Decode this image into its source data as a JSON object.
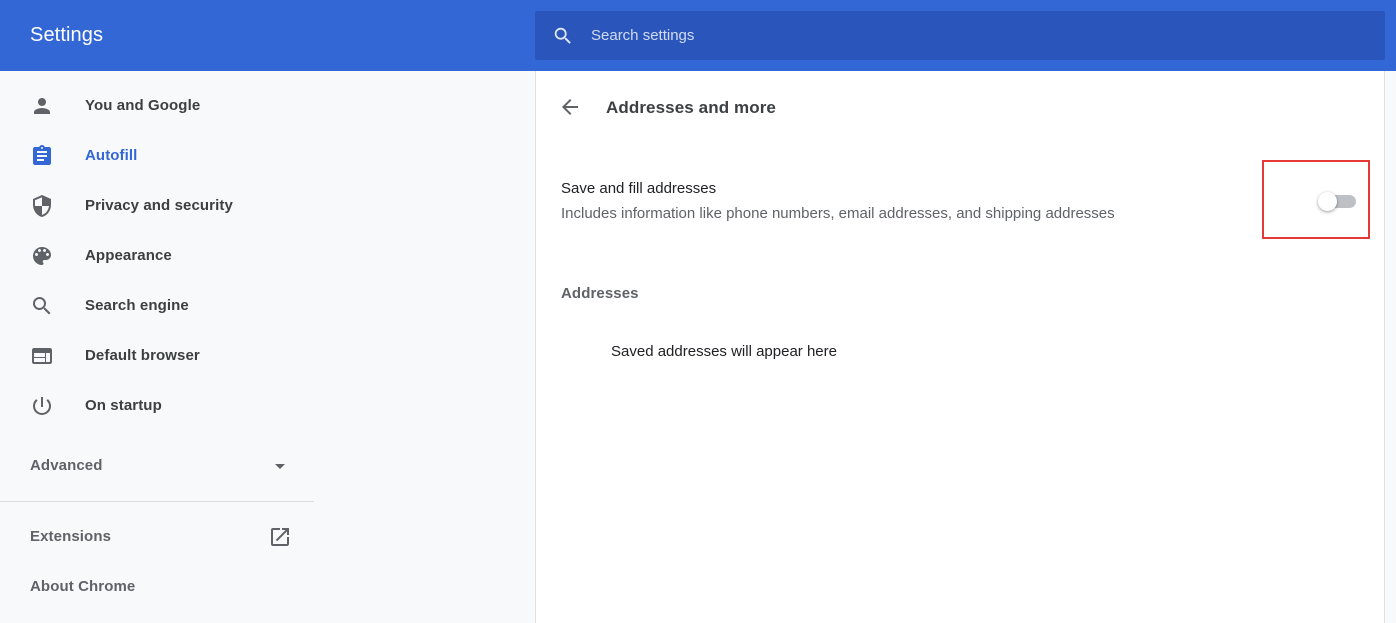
{
  "header": {
    "title": "Settings",
    "search_placeholder": "Search settings",
    "search_value": ""
  },
  "sidebar": {
    "items": [
      {
        "label": "You and Google",
        "icon": "person-icon",
        "active": false
      },
      {
        "label": "Autofill",
        "icon": "autofill-clipboard-icon",
        "active": true
      },
      {
        "label": "Privacy and security",
        "icon": "shield-icon",
        "active": false
      },
      {
        "label": "Appearance",
        "icon": "palette-icon",
        "active": false
      },
      {
        "label": "Search engine",
        "icon": "search-icon",
        "active": false
      },
      {
        "label": "Default browser",
        "icon": "browser-window-icon",
        "active": false
      },
      {
        "label": "On startup",
        "icon": "power-icon",
        "active": false
      }
    ],
    "advanced_label": "Advanced",
    "extensions_label": "Extensions",
    "about_label": "About Chrome"
  },
  "main": {
    "title": "Addresses and more",
    "save_fill": {
      "title": "Save and fill addresses",
      "description": "Includes information like phone numbers, email addresses, and shipping addresses",
      "enabled": false
    },
    "addresses_header": "Addresses",
    "empty_message": "Saved addresses will appear here"
  },
  "colors": {
    "header_bg": "#3367d6",
    "search_bg": "#2a56bc",
    "accent": "#3367d6",
    "highlight_border": "#e53935"
  }
}
